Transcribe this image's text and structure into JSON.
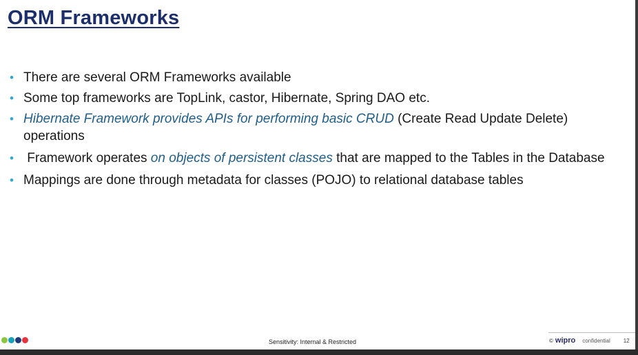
{
  "slide": {
    "title": "ORM Frameworks",
    "bullets": [
      {
        "text": "There are several ORM Frameworks available"
      },
      {
        "text": "Some top frameworks are TopLink, castor, Hibernate, Spring DAO etc."
      },
      {
        "emphasis": "Hibernate Framework provides APIs for performing basic CRUD",
        "rest": " (Create Read Update Delete) operations"
      },
      {
        "lead": " Framework operates ",
        "emphasis": "on objects of persistent classes",
        "rest": " that are mapped to the Tables in the Database"
      },
      {
        "text": "Mappings are done through metadata for classes (POJO) to relational database tables"
      }
    ],
    "bullet_glyph": "•",
    "bullet_color": "#2aa8d6",
    "title_color": "#1c2f6b",
    "emphasis_color": "#1f5e8a"
  },
  "footer": {
    "dots": [
      {
        "name": "green-dot",
        "color": "#8cc63f"
      },
      {
        "name": "teal-dot",
        "color": "#17a2b8"
      },
      {
        "name": "navy-dot",
        "color": "#1f3a7a"
      },
      {
        "name": "red-dot",
        "color": "#e8333c"
      }
    ],
    "sensitivity": "Sensitivity: Internal & Restricted",
    "copyright": "©",
    "brand": "wipro",
    "confidential": "confidential",
    "page_number": "12"
  }
}
